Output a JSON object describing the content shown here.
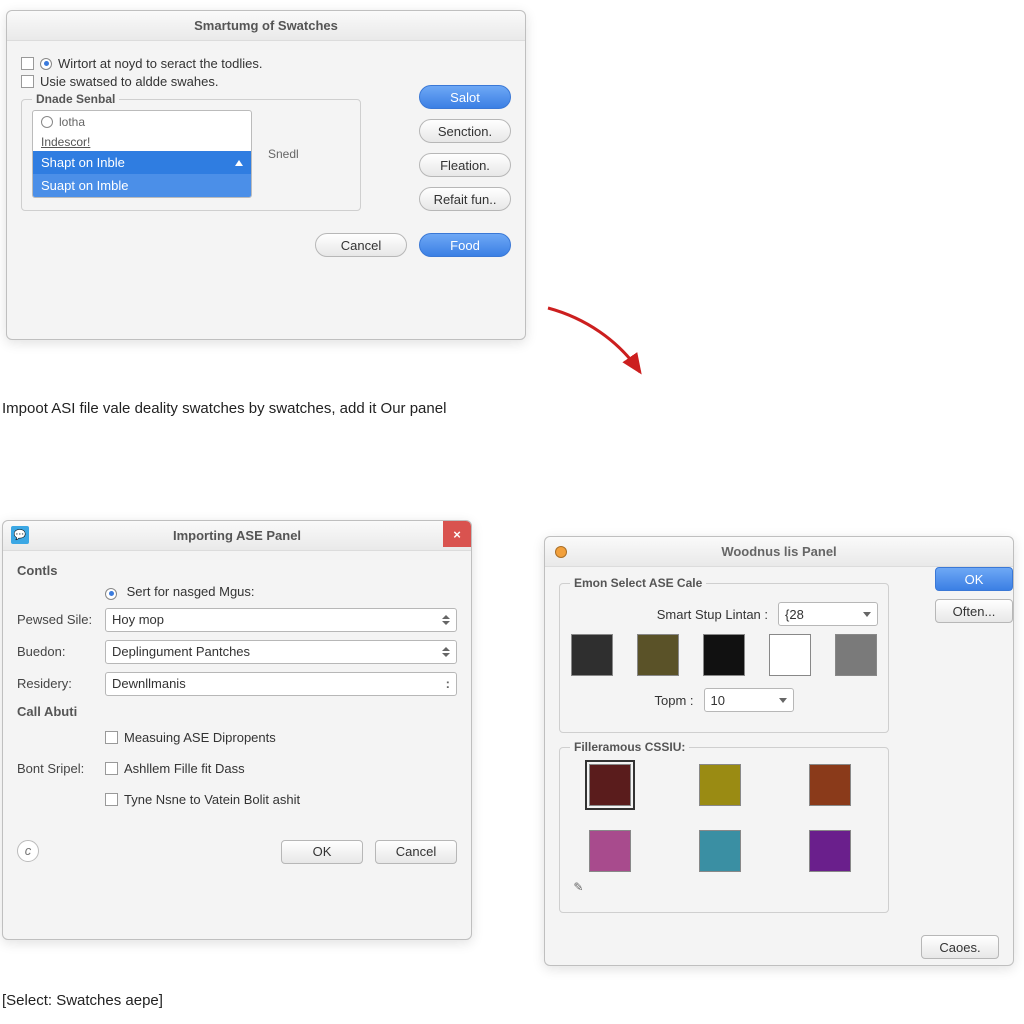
{
  "dlg1": {
    "title": "Smartumg of Swatches",
    "check1": "Wirtort at noyd to seract the todlies.",
    "check2": "Usie swatsed to aldde swahes.",
    "group_legend": "Dnade Senbal",
    "list_head": "lotha",
    "list_link": "Indescor!",
    "list_row1": "Shapt on Inble",
    "list_row2": "Suapt on Imble",
    "side_label": "Snedl",
    "btn_salot": "Salot",
    "btn_senction": "Senction.",
    "btn_fleation": "Fleation.",
    "btn_refait": "Refait fun..",
    "btn_cancel": "Cancel",
    "btn_food": "Food"
  },
  "dlg2": {
    "title": "Importing ASE Panel",
    "section": "Contls",
    "radio_label": "Sert for nasged Mgus:",
    "row1_label": "Pewsed Sile:",
    "row1_value": "Hoy mop",
    "row2_label": "Buedon:",
    "row2_value": "Deplingument Pantches",
    "row3_label": "Residery:",
    "row3_value": "Dewnllmanis",
    "call_section": "Call Abuti",
    "bont_label": "Bont Sripel:",
    "chk1": "Measuing ASE Dipropents",
    "chk2": "Ashllem Fille fit Dass",
    "chk3": "Tyne Nsne to Vatein Bolit ashit",
    "btn_ok": "OK",
    "btn_cancel": "Cancel"
  },
  "dlg3": {
    "title": "Woodnus lis Panel",
    "group1": "Emon Select ASE Cale",
    "row1_label": "Smart Stup Lintan :",
    "row1_value": "{28",
    "row2_label": "Topm :",
    "row2_value": "10",
    "group2": "Filleramous CSSIU:",
    "swatches": [
      "#2f2f2f",
      "#5a5228",
      "#111111",
      "#ffffff",
      "#7a7a7a"
    ],
    "swatches2": [
      "#5a1c1c",
      "#9a8b13",
      "#8a3a1a",
      "#a84b8d",
      "#3a8fa3",
      "#6a1f8c"
    ],
    "btn_ok": "OK",
    "btn_often": "Often...",
    "btn_caoes": "Caoes."
  },
  "caption1": "Impoot ASI file vale deality swatches by swatches, add it Our panel",
  "caption2": "[Select: Swatches aepe]"
}
